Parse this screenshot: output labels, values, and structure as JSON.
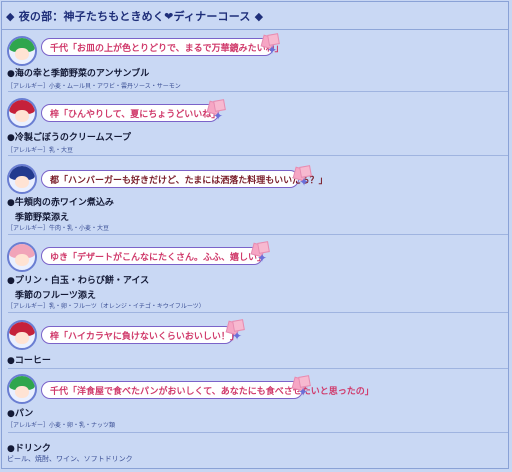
{
  "header": {
    "title": "◆ 夜の部：神子たちもときめく❤ディナーコース ◆"
  },
  "items": [
    {
      "speaker": "千代",
      "quote": "「お皿の上が色とりどりで、まるで万華鏡みたいね」",
      "avatar_hair": "#2fa64d",
      "dish": "●海の幸と季節野菜のアンサンブル",
      "subdish": "",
      "allergy": "［アレルギー］小麦・ムール貝・アワビ・雲丹ソース・サーモン"
    },
    {
      "speaker": "梓",
      "quote": "「ひんやりして、夏にちょうどいいね」",
      "avatar_hair": "#c5213a",
      "dish": "●冷製ごぼうのクリームスープ",
      "subdish": "",
      "allergy": "［アレルギー］乳・大豆"
    },
    {
      "speaker": "都",
      "quote": "「ハンバーガーも好きだけど、たまには洒落た料理もいいだろ？」",
      "avatar_hair": "#223a8e",
      "dish": "●牛頬肉の赤ワイン煮込み",
      "subdish": "季節野菜添え",
      "allergy": "［アレルギー］牛肉・乳・小麦・大豆"
    },
    {
      "speaker": "ゆき",
      "quote": "「デザートがこんなにたくさん。ふふ、嬉しい」",
      "avatar_hair": "#f1a4b9",
      "dish": "●プリン・白玉・わらび餅・アイス",
      "subdish": "季節のフルーツ添え",
      "allergy": "［アレルギー］乳・卵・フルーツ（オレンジ・イチゴ・キウイフルーツ）"
    },
    {
      "speaker": "梓",
      "quote": "「ハイカラヤに負けないくらいおいしい！」",
      "avatar_hair": "#c5213a",
      "dish": "●コーヒー",
      "subdish": "",
      "allergy": ""
    },
    {
      "speaker": "千代",
      "quote": "「洋食屋で食べたパンがおいしくて、あなたにも食べさせたいと思ったの」",
      "avatar_hair": "#2fa64d",
      "dish": "●パン",
      "subdish": "",
      "allergy": "［アレルギー］小麦・卵・乳・ナッツ類"
    }
  ],
  "drink": {
    "title": "●ドリンク",
    "desc": "ビール、焼酎、ワイン、ソフトドリンク"
  }
}
